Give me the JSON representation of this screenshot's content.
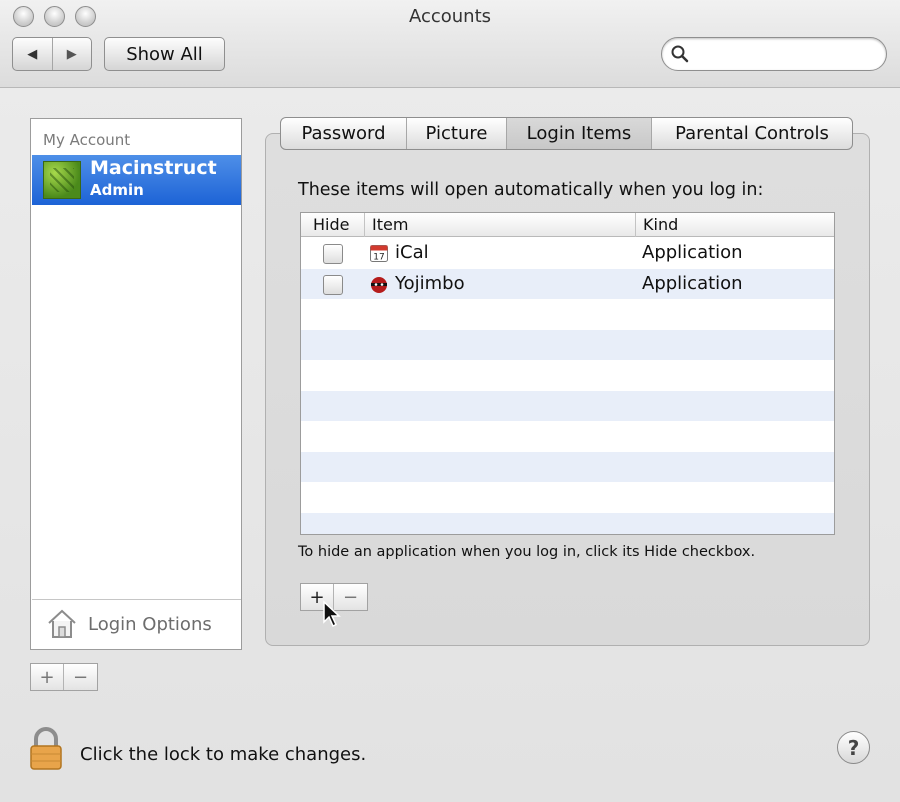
{
  "window": {
    "title": "Accounts"
  },
  "toolbar": {
    "back_label": "◀",
    "forward_label": "▶",
    "show_all_label": "Show All",
    "search_value": "",
    "search_placeholder": ""
  },
  "accounts": {
    "section_label": "My Account",
    "items": [
      {
        "name": "Macinstruct",
        "role": "Admin",
        "selected": true
      }
    ],
    "login_options_label": "Login Options",
    "add_label": "+",
    "remove_label": "−"
  },
  "tabs": [
    {
      "label": "Password",
      "active": false
    },
    {
      "label": "Picture",
      "active": false
    },
    {
      "label": "Login Items",
      "active": true
    },
    {
      "label": "Parental Controls",
      "active": false
    }
  ],
  "login_items": {
    "intro": "These items will open automatically when you log in:",
    "columns": {
      "hide": "Hide",
      "item": "Item",
      "kind": "Kind"
    },
    "rows": [
      {
        "hide": false,
        "item": "iCal",
        "kind": "Application",
        "icon": "calendar-icon"
      },
      {
        "hide": false,
        "item": "Yojimbo",
        "kind": "Application",
        "icon": "yojimbo-icon"
      }
    ],
    "hint": "To hide an application when you log in, click its Hide checkbox.",
    "add_label": "+",
    "remove_label": "−"
  },
  "footer": {
    "lock_text": "Click the lock to make changes.",
    "help_label": "?"
  },
  "colors": {
    "selection": "#1d63d6",
    "stripe": "#e8eef9",
    "lock": "#e8a44a"
  }
}
